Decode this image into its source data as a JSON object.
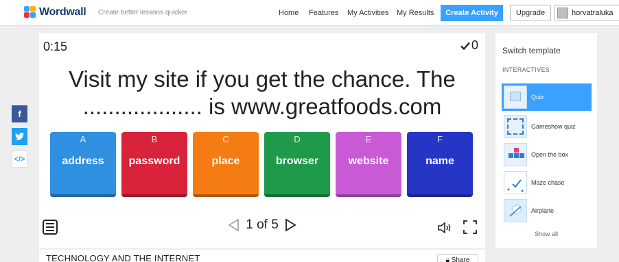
{
  "header": {
    "brand": "Wordwall",
    "tagline": "Create better lessons quicker",
    "nav": [
      "Home",
      "Features",
      "My Activities",
      "My Results"
    ],
    "create_label": "Create Activity",
    "upgrade_label": "Upgrade",
    "username": "horvatraluka"
  },
  "game": {
    "timer": "0:15",
    "score": "0",
    "question_line1": "Visit my site if you get the chance. The",
    "question_line2": "................... is www.greatfoods.com",
    "answers": [
      {
        "letter": "A",
        "word": "address",
        "color": "#2f8fe0"
      },
      {
        "letter": "B",
        "word": "password",
        "color": "#d8233a"
      },
      {
        "letter": "C",
        "word": "place",
        "color": "#f57c13"
      },
      {
        "letter": "D",
        "word": "browser",
        "color": "#1f9a4a"
      },
      {
        "letter": "E",
        "word": "website",
        "color": "#c95ad6"
      },
      {
        "letter": "F",
        "word": "name",
        "color": "#2535c5"
      }
    ],
    "pager": "1 of 5",
    "title": "TECHNOLOGY AND THE INTERNET",
    "share_label": "Share"
  },
  "sidebar": {
    "title": "Switch template",
    "section": "INTERACTIVES",
    "templates": [
      "Quiz",
      "Gameshow quiz",
      "Open the box",
      "Maze chase",
      "Airplane"
    ],
    "show_all": "Show all"
  },
  "colors": {
    "accent": "#3aa1ff",
    "facebook": "#3b5998",
    "twitter": "#1da1f2"
  }
}
